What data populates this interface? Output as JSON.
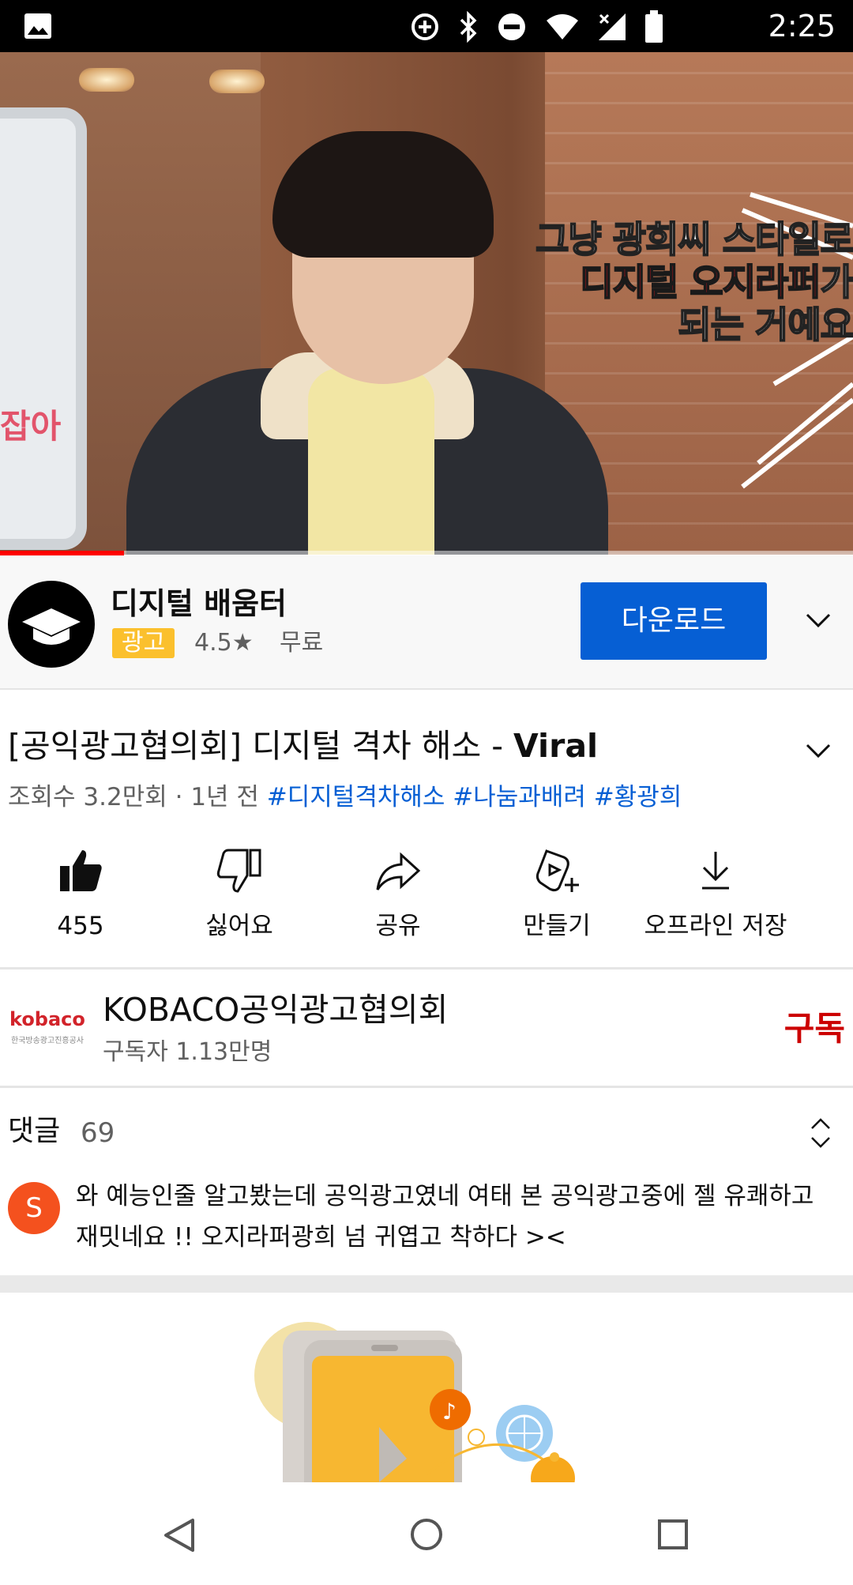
{
  "status_bar": {
    "time": "2:25",
    "icons": [
      "gallery-icon",
      "data-saver-icon",
      "bluetooth-icon",
      "do-not-disturb-icon",
      "wifi-icon",
      "signal-icon",
      "battery-icon"
    ]
  },
  "video": {
    "caption_line1": "그냥 광희씨 스타일로",
    "caption_line2_red": "디지털 오지라퍼",
    "caption_line2_suffix": "가",
    "caption_line3": "되는 거예요",
    "kiosk_text": "잡아",
    "progress_fraction": 0.145
  },
  "ad": {
    "title": "디지털 배움터",
    "badge": "광고",
    "rating": "4.5★",
    "price": "무료",
    "download_label": "다운로드"
  },
  "video_info": {
    "title_prefix": "[공익광고협의회] 디지털 격차 해소 - ",
    "title_bold": "Viral",
    "views": "조회수 3.2만회 · 1년 전",
    "hashtags": [
      "#디지털격차해소",
      "#나눔과배려",
      "#황광희"
    ]
  },
  "actions": [
    {
      "label": "455",
      "icon": "thumbs-up-icon"
    },
    {
      "label": "싫어요",
      "icon": "thumbs-down-icon"
    },
    {
      "label": "공유",
      "icon": "share-icon"
    },
    {
      "label": "만들기",
      "icon": "create-icon"
    },
    {
      "label": "오프라인 저장",
      "icon": "download-icon"
    }
  ],
  "channel": {
    "logo_text": "kobaco",
    "logo_subtext": "한국방송광고진흥공사",
    "name": "KOBACO공익광고협의회",
    "subscribers": "구독자 1.13만명",
    "subscribe_label": "구독"
  },
  "comments": {
    "header": "댓글",
    "count": "69",
    "first_avatar_letter": "S",
    "first_comment": "와 예능인줄 알고봤는데 공익광고였네 여태 본 공익광고중에 젤 유쾌하고 재밋네요 !! 오지라퍼광희 넘 귀엽고 착하다 ><"
  },
  "colors": {
    "accent_blue": "#065fd4",
    "subscribe_red": "#cc0000",
    "ad_badge": "#fbc02d",
    "progress": "#ff0000"
  }
}
